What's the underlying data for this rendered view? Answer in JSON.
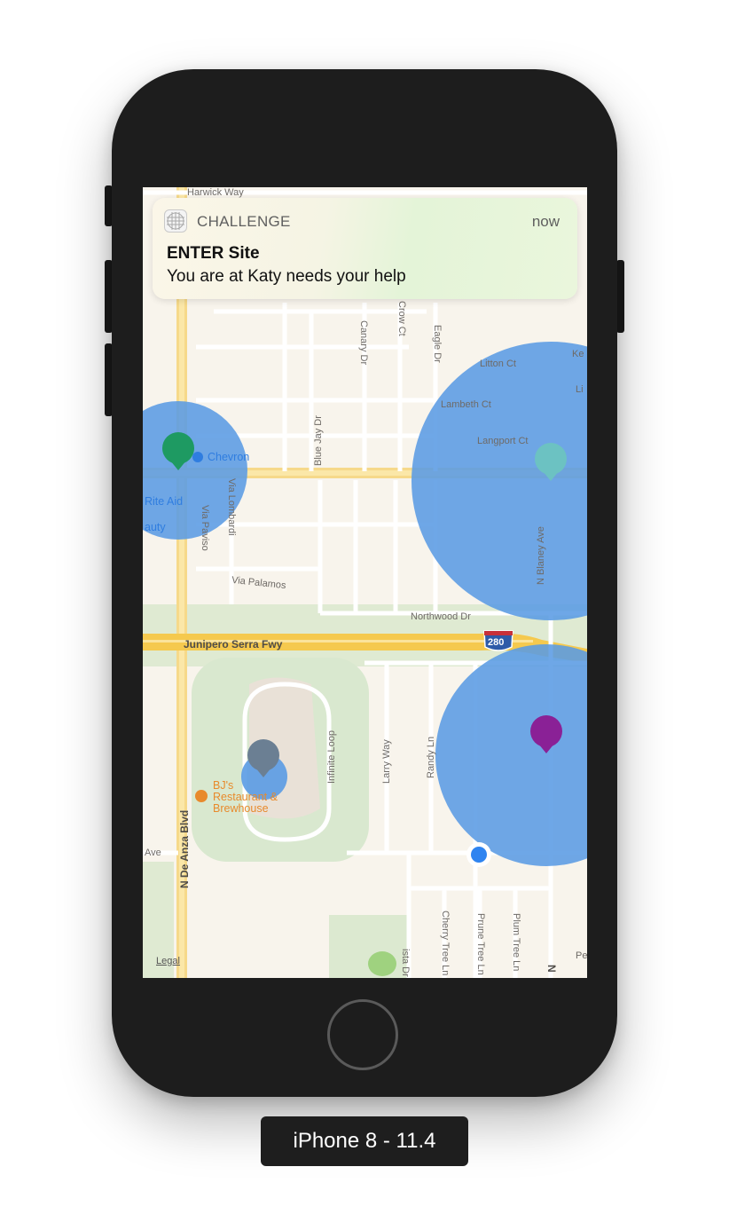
{
  "notification": {
    "app_name": "CHALLENGE",
    "time": "now",
    "title": "ENTER Site",
    "body": "You are at Katy needs your help"
  },
  "map": {
    "streets": {
      "harwick": "Harwick Way",
      "crow": "Crow Ct",
      "eagle": "Eagle Dr",
      "canary": "Canary Dr",
      "litton": "Litton Ct",
      "lambeth": "Lambeth Ct",
      "langport": "Langport Ct",
      "bluejay": "Blue Jay Dr",
      "via_lombardi": "Via Lombardi",
      "via_pavioso": "Via Paviso",
      "via_palamos": "Via Palamos",
      "northwood": "Northwood Dr",
      "n_blaney": "N Blaney Ave",
      "junipero": "Junipero Serra Fwy",
      "interstate": "280",
      "infinite_loop": "Infinite Loop",
      "larry": "Larry Way",
      "randy": "Randy Ln",
      "n_de_anza": "N De Anza Blvd",
      "ave_stub": "Ave",
      "cherry_tree": "Cherry Tree Ln",
      "prune_tree": "Prune Tree Ln",
      "plum_tree": "Plum Tree Ln",
      "vista": "ista Dr",
      "pe": "Pe",
      "ke": "Ke",
      "li": "Li",
      "n_right": "N"
    },
    "pois": {
      "chevron": "Chevron",
      "rite_aid": "Rite Aid",
      "beauty": "auty",
      "bjs_line1": "BJ's",
      "bjs_line2": "Restaurant &",
      "bjs_line3": "Brewhouse"
    },
    "legal": "Legal",
    "colors": {
      "region_fill": "#5a9be4",
      "pin_green": "#1e9a62",
      "pin_teal": "#6cc2c2",
      "pin_purple": "#8a2196",
      "pin_slate": "#6b7f93",
      "user_location": "#2f84f0"
    }
  },
  "device": {
    "label": "iPhone 8 - 11.4"
  }
}
